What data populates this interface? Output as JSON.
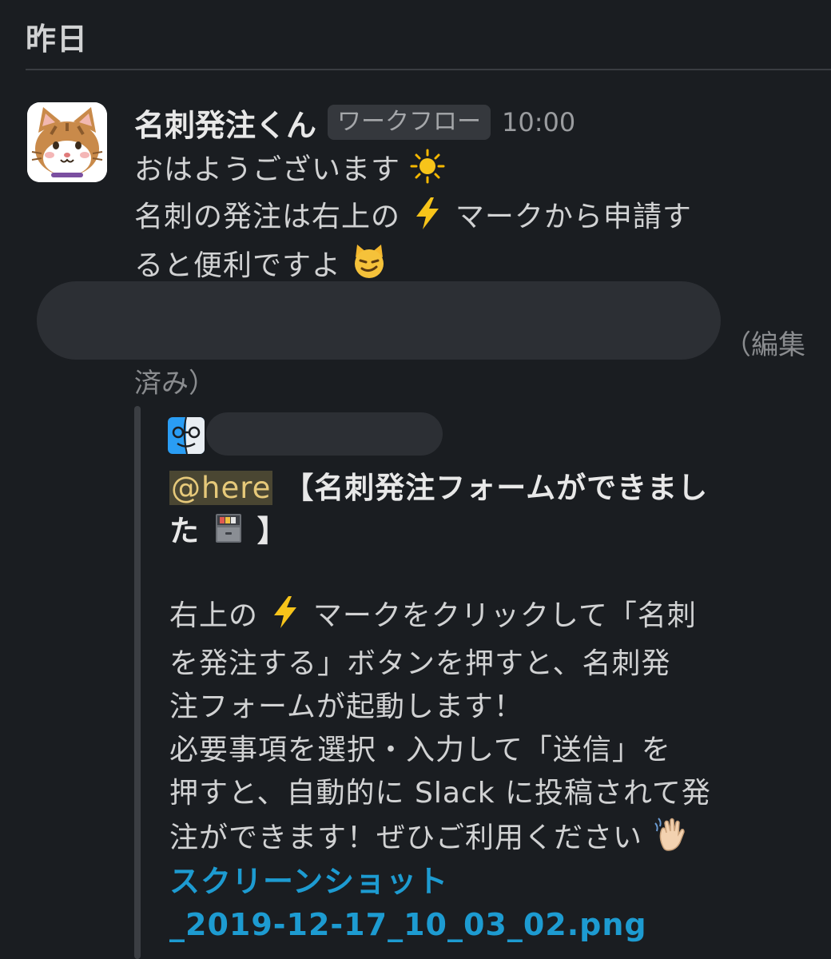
{
  "day_header": "昨日",
  "message": {
    "sender": "名刺発注くん",
    "badge": "ワークフロー",
    "time": "10:00",
    "line1": "おはようございます",
    "line2a": "名刺の発注は右上の",
    "line2b": "マークから申請す",
    "line3": "ると便利ですよ",
    "emoji": {
      "sun": "sun-icon",
      "bolt": "lightning-icon",
      "cat": "smirking-cat-icon"
    }
  },
  "edited": {
    "part1": "（編集",
    "part2": "済み）"
  },
  "quote": {
    "mention": "@here",
    "title_a": "【名刺発注フォームができまし",
    "title_b": "た",
    "title_c": "】",
    "text_l1a": "右上の",
    "text_l1b": "マークをクリックして「名刺",
    "text_l2": "を発注する」ボタンを押すと、名刺発",
    "text_l3": "注フォームが起動します！",
    "text_l4": "必要事項を選択・入力して「送信」を",
    "text_l5": "押すと、自動的に Slack に投稿されて発",
    "text_l6": "注ができます！ぜひご利用ください",
    "emoji": {
      "cabinet": "file-cabinet-icon",
      "wave": "waving-hand-icon",
      "finder": "finder-icon"
    }
  },
  "attachment": {
    "line1": "スクリーンショット",
    "line2": "_2019-12-17_10_03_02.png"
  },
  "colors": {
    "background": "#1a1d21",
    "text": "#d1d2d3",
    "link": "#1d9bd1",
    "mention_bg": "#4a4632"
  }
}
